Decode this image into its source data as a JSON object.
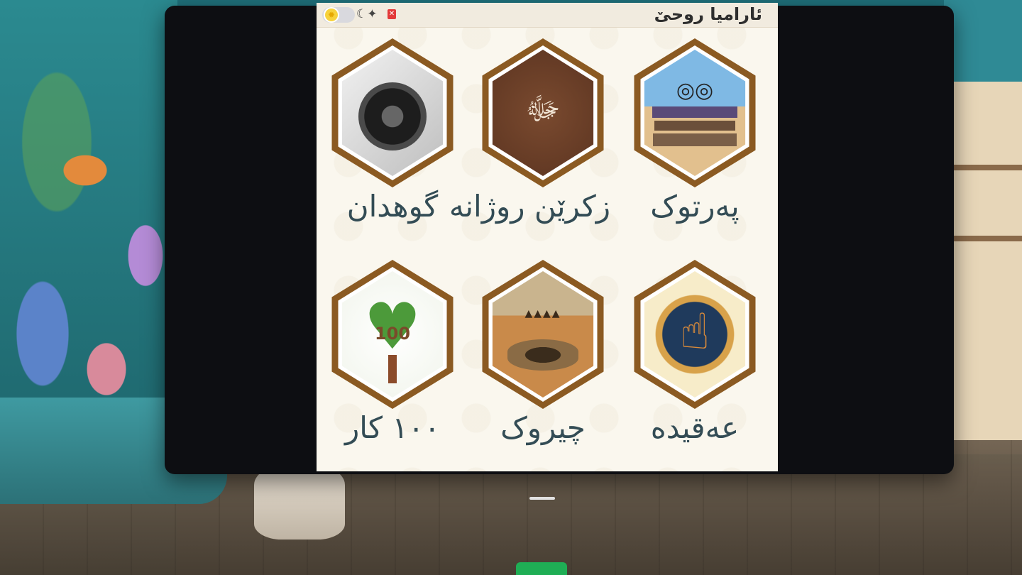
{
  "app": {
    "title": "ئارامیا روحێ",
    "icons": {
      "theme_toggle": "sun-icon",
      "night_mode": "moon-star-icon",
      "delete": "trash-icon"
    }
  },
  "tiles": [
    {
      "label": "پەرتوک",
      "image": "books-with-glasses"
    },
    {
      "label": "زکرێن روژانه",
      "image": "calligraphy"
    },
    {
      "label": "گوهدان",
      "image": "headphones"
    },
    {
      "label": "عەقیدە",
      "image": "raised-finger"
    },
    {
      "label": "چیروک",
      "image": "desert-well"
    },
    {
      "label": "١٠٠ کار",
      "image": "tree-heart-100"
    }
  ],
  "tree_badge": "100",
  "colors": {
    "hex_border": "#8b5a22",
    "label_text": "#334c55",
    "panel_bg": "#faf7ee",
    "delete_red": "#e33a3a"
  }
}
